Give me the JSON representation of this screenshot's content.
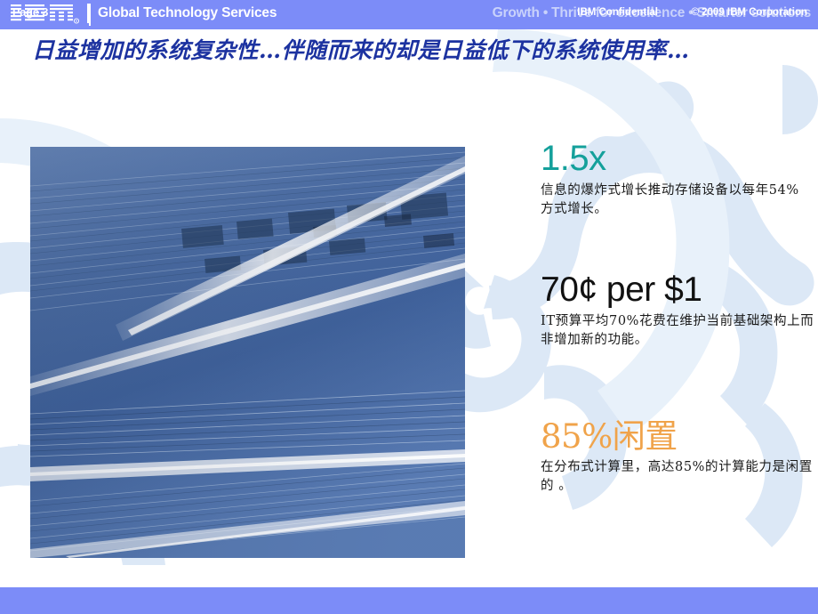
{
  "header": {
    "logo_alt": "IBM",
    "business_unit": "Global Technology Services",
    "tagline": "Growth • Thrive for excellence • Smarter solutions",
    "band_color": "#7C8CF8",
    "tagline_color": "#C9D2FB"
  },
  "title": {
    "text": "日益增加的系统复杂性…伴随而来的却是日益低下的系统使用率…",
    "color": "#1C32A0"
  },
  "photo": {
    "caption": "abstract blue data center server racks perspective photograph"
  },
  "stats": [
    {
      "headline": "1.5x",
      "headline_color": "#14A09B",
      "body": "信息的爆炸式增长推动存储设备以每年54%方式增长。",
      "metric": "54%"
    },
    {
      "headline": "70¢ per $1",
      "headline_color": "#111111",
      "body": "IT预算平均70%花费在维护当前基础架构上而非增加新的功能。",
      "metric": "70%"
    },
    {
      "headline": "85%闲置",
      "headline_color": "#F0A34A",
      "body": "在分布式计算里，高达85%的计算能力是闲置的 。",
      "metric": "85%"
    }
  ],
  "footer": {
    "page_label": "Page 3",
    "confidential": "IBM Confidential",
    "copyright": "© 2009 IBM Corporation",
    "band_color": "#7C8CF8"
  }
}
